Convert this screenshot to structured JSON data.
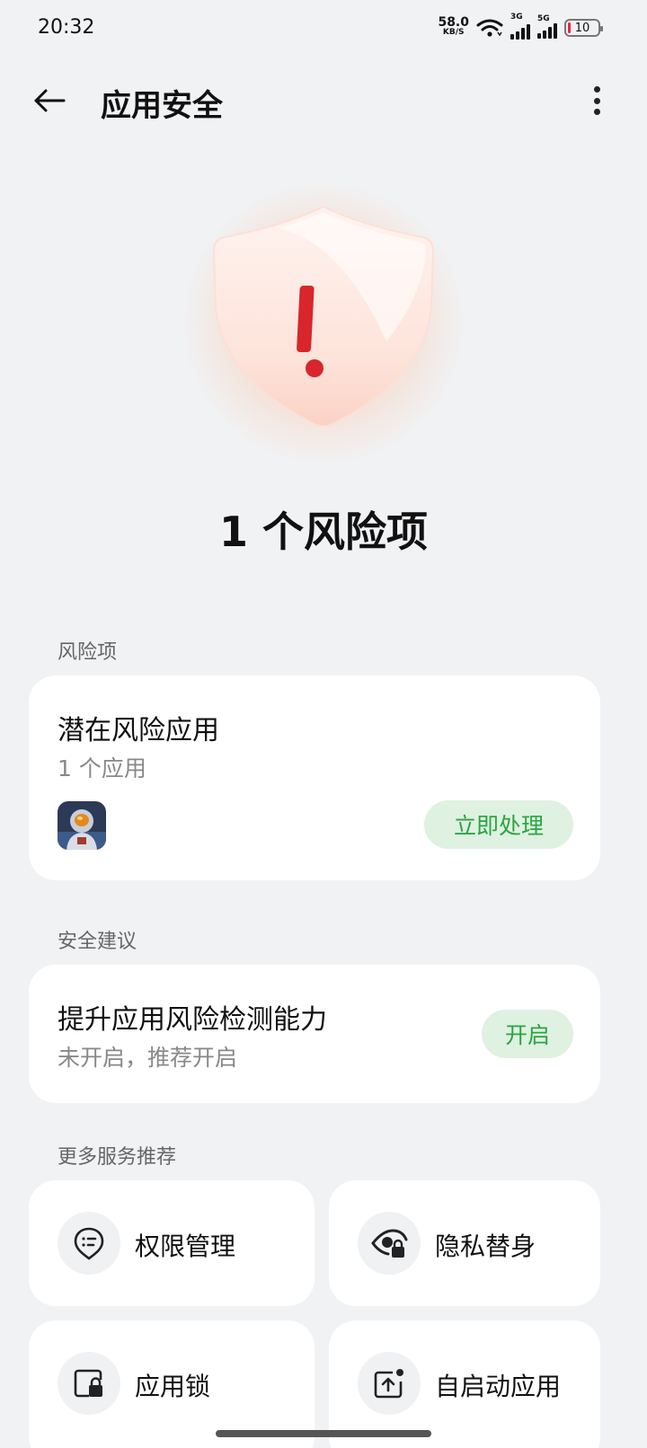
{
  "status_bar": {
    "time": "20:32",
    "net_speed_value": "58.0",
    "net_speed_unit": "KB/S",
    "signal1_label": "3G",
    "signal2_label": "5G",
    "battery": "10"
  },
  "header": {
    "title": "应用安全"
  },
  "summary": {
    "risk_count_text": "1 个风险项"
  },
  "risk_section": {
    "label": "风险项",
    "card_title": "潜在风险应用",
    "card_sub": "1 个应用",
    "action_label": "立即处理"
  },
  "advice_section": {
    "label": "安全建议",
    "card_title": "提升应用风险检测能力",
    "card_sub": "未开启，推荐开启",
    "action_label": "开启"
  },
  "services_section": {
    "label": "更多服务推荐",
    "items": [
      {
        "label": "权限管理",
        "icon": "permission-icon"
      },
      {
        "label": "隐私替身",
        "icon": "privacy-icon"
      },
      {
        "label": "应用锁",
        "icon": "app-lock-icon"
      },
      {
        "label": "自启动应用",
        "icon": "auto-start-icon"
      }
    ]
  },
  "colors": {
    "accent_green": "#2aa542",
    "pill_bg": "#dff1e1",
    "alert_red": "#d8262c"
  }
}
